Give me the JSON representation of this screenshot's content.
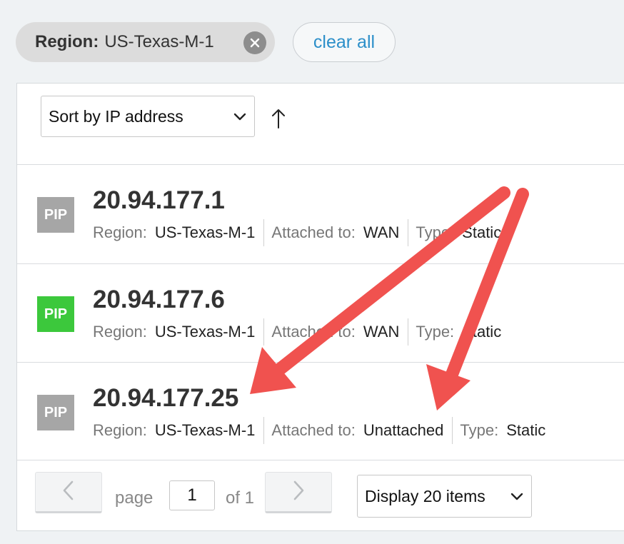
{
  "filters": {
    "chip": {
      "key": "Region:",
      "value": "US-Texas-M-1",
      "remove_icon": "close-icon"
    },
    "clear_all": "clear all"
  },
  "sort": {
    "selected": "Sort by IP address",
    "direction_icon": "arrow-up-icon"
  },
  "labels": {
    "region": "Region:",
    "attached": "Attached to:",
    "type": "Type:"
  },
  "rows": [
    {
      "badge": "PIP",
      "badge_color": "#a6a6a6",
      "ip": "20.94.177.1",
      "region": "US-Texas-M-1",
      "attached": "WAN",
      "type": "Static"
    },
    {
      "badge": "PIP",
      "badge_color": "#3cc83c",
      "ip": "20.94.177.6",
      "region": "US-Texas-M-1",
      "attached": "WAN",
      "type": "Static"
    },
    {
      "badge": "PIP",
      "badge_color": "#a6a6a6",
      "ip": "20.94.177.25",
      "region": "US-Texas-M-1",
      "attached": "Unattached",
      "type": "Static"
    }
  ],
  "pagination": {
    "page_label": "page",
    "page": "1",
    "of_label": "of 1",
    "display": "Display 20 items"
  },
  "colors": {
    "annotation_arrow": "#f0524f",
    "link": "#2c8fc9"
  }
}
